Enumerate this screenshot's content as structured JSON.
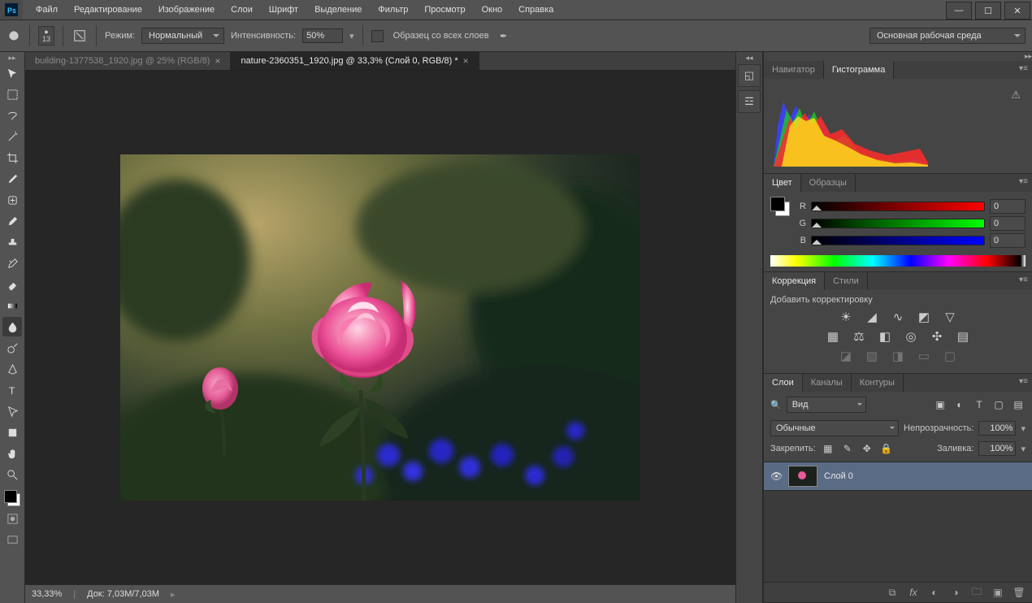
{
  "menu": [
    "Файл",
    "Редактирование",
    "Изображение",
    "Слои",
    "Шрифт",
    "Выделение",
    "Фильтр",
    "Просмотр",
    "Окно",
    "Справка"
  ],
  "options": {
    "brush_size": "13",
    "mode_label": "Режим:",
    "mode_value": "Нормальный",
    "intensity_label": "Интенсивность:",
    "intensity_value": "50%",
    "sample_all": "Образец со всех слоев",
    "workspace": "Основная рабочая среда"
  },
  "tabs": [
    {
      "label": "building-1377538_1920.jpg @ 25% (RGB/8)",
      "active": false
    },
    {
      "label": "nature-2360351_1920.jpg @ 33,3% (Слой 0, RGB/8) *",
      "active": true
    }
  ],
  "status": {
    "zoom": "33,33%",
    "doc_label": "Док:",
    "doc_size": "7,03M/7,03M"
  },
  "panels": {
    "nav": {
      "tabs": [
        "Навигатор",
        "Гистограмма"
      ],
      "active": 1
    },
    "color": {
      "tabs": [
        "Цвет",
        "Образцы"
      ],
      "active": 0,
      "R": "0",
      "G": "0",
      "B": "0"
    },
    "correction": {
      "tabs": [
        "Коррекция",
        "Стили"
      ],
      "active": 0,
      "add_label": "Добавить корректировку"
    },
    "layers": {
      "tabs": [
        "Слои",
        "Каналы",
        "Контуры"
      ],
      "active": 0,
      "kind": "Вид",
      "blend": "Обычные",
      "opacity_label": "Непрозрачность:",
      "opacity": "100%",
      "lock_label": "Закрепить:",
      "fill_label": "Заливка:",
      "fill": "100%",
      "layer0": "Слой 0"
    }
  }
}
